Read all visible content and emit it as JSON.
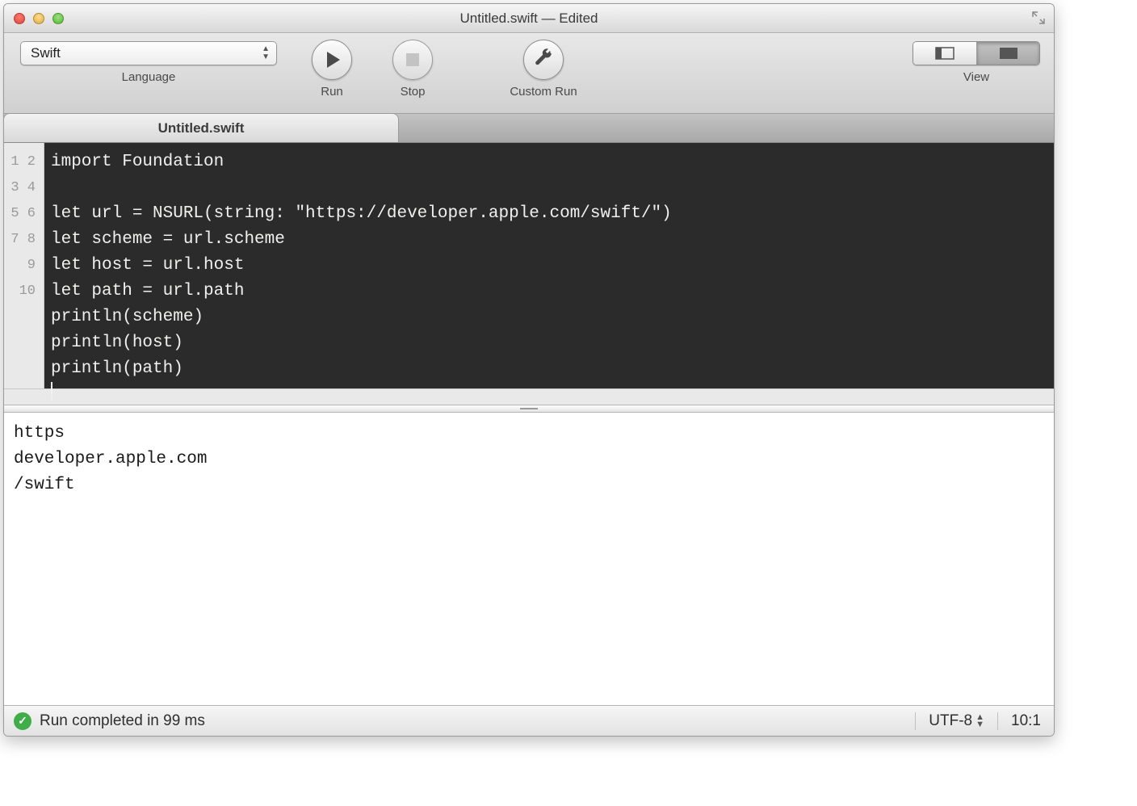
{
  "window": {
    "title": "Untitled.swift — Edited"
  },
  "toolbar": {
    "language": {
      "label": "Language",
      "value": "Swift"
    },
    "run": {
      "label": "Run"
    },
    "stop": {
      "label": "Stop"
    },
    "custom": {
      "label": "Custom Run"
    },
    "view": {
      "label": "View"
    }
  },
  "tabs": [
    {
      "label": "Untitled.swift"
    }
  ],
  "editor": {
    "line_numbers": [
      "1",
      "2",
      "3",
      "4",
      "5",
      "6",
      "7",
      "8",
      "9",
      "10"
    ],
    "code": "import Foundation\n\nlet url = NSURL(string: \"https://developer.apple.com/swift/\")\nlet scheme = url.scheme\nlet host = url.host\nlet path = url.path\nprintln(scheme)\nprintln(host)\nprintln(path)\n"
  },
  "output": "https\ndeveloper.apple.com\n/swift",
  "status": {
    "message": "Run completed in 99 ms",
    "encoding": "UTF-8",
    "cursor": "10:1"
  }
}
